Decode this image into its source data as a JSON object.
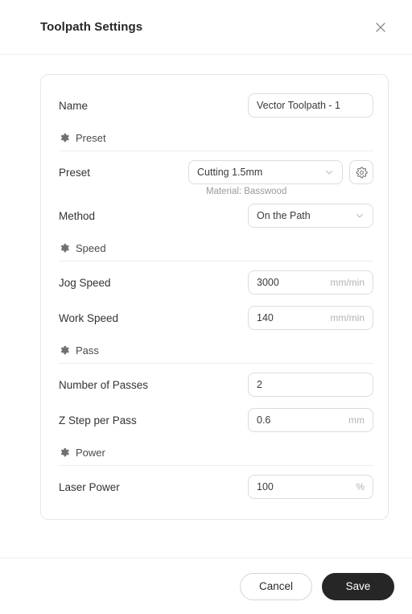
{
  "header": {
    "title": "Toolpath Settings",
    "close_icon": "close-icon"
  },
  "form": {
    "name_row": {
      "label": "Name",
      "value": "Vector Toolpath - 1"
    },
    "sections": [
      {
        "id": "preset",
        "label": "Preset",
        "icon": "gear-icon"
      },
      {
        "id": "speed",
        "label": "Speed",
        "icon": "gear-icon"
      },
      {
        "id": "pass",
        "label": "Pass",
        "icon": "gear-icon"
      },
      {
        "id": "power",
        "label": "Power",
        "icon": "gear-icon"
      }
    ],
    "preset_row": {
      "label": "Preset",
      "value": "Cutting 1.5mm",
      "chevron_icon": "chevron-down-icon",
      "settings_icon": "gear-icon",
      "helper": "Material: Basswood"
    },
    "method_row": {
      "label": "Method",
      "value": "On the Path",
      "chevron_icon": "chevron-down-icon"
    },
    "jog_speed_row": {
      "label": "Jog Speed",
      "value": "3000",
      "unit": "mm/min"
    },
    "work_speed_row": {
      "label": "Work Speed",
      "value": "140",
      "unit": "mm/min"
    },
    "passes_row": {
      "label": "Number of Passes",
      "value": "2",
      "unit": ""
    },
    "zstep_row": {
      "label": "Z Step per Pass",
      "value": "0.6",
      "unit": "mm"
    },
    "laser_power_row": {
      "label": "Laser Power",
      "value": "100",
      "unit": "%"
    }
  },
  "footer": {
    "cancel_label": "Cancel",
    "save_label": "Save"
  },
  "colors": {
    "primary_button": "#262626",
    "border": "#dcdcdc",
    "divider": "#ededed",
    "muted_text": "#9a9a9a"
  }
}
